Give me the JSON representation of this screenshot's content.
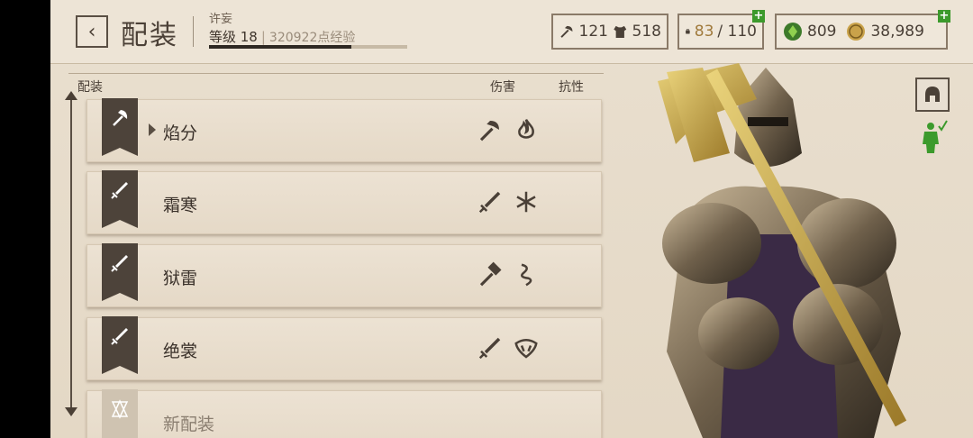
{
  "header": {
    "title": "配装",
    "player_name": "许妄",
    "level_label": "等级 18",
    "xp_text": "320922点经验",
    "xp_progress": 0.72
  },
  "stats": {
    "attack": "121",
    "armor": "518",
    "inventory_used": "83",
    "inventory_cap": "/ 110",
    "gems": "809",
    "gold": "38,989"
  },
  "list": {
    "col_loadout": "配装",
    "col_damage": "伤害",
    "col_resist": "抗性",
    "items": [
      {
        "label": "焰分",
        "weapon": "axe-icon",
        "damage": "axe-icon",
        "resist": "fire-icon"
      },
      {
        "label": "霜寒",
        "weapon": "sword-icon",
        "damage": "sword-icon",
        "resist": "frost-icon"
      },
      {
        "label": "狱雷",
        "weapon": "sword-icon",
        "damage": "hammer-icon",
        "resist": "shock-icon"
      },
      {
        "label": "绝裳",
        "weapon": "sword-icon",
        "damage": "sword-icon",
        "resist": "poison-icon"
      },
      {
        "label": "新配装",
        "weapon": "empty-icon"
      }
    ]
  },
  "colors": {
    "accent_green": "#3c9a2c",
    "dark": "#4d433a",
    "gold": "#b8923a",
    "parchment": "#e6dccb"
  }
}
